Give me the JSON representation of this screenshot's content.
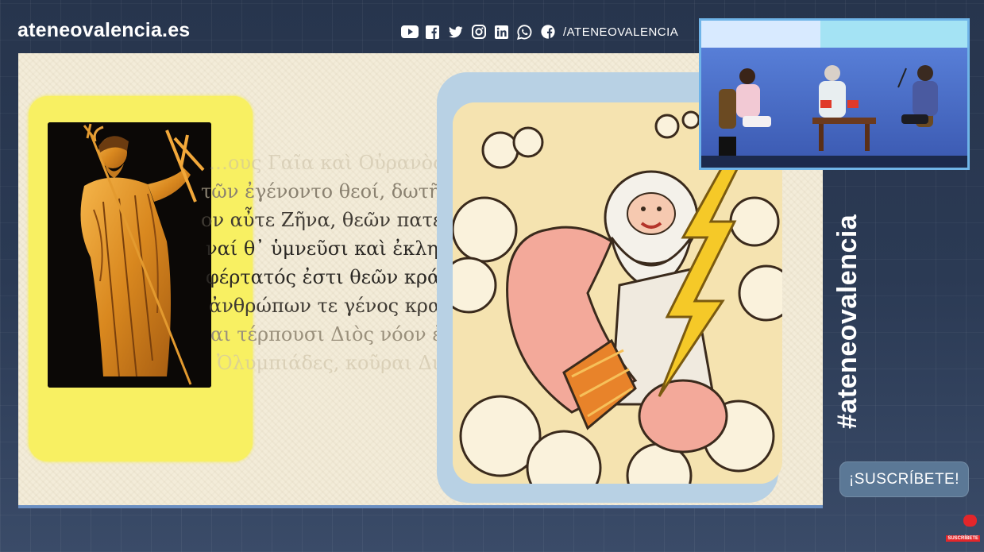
{
  "header": {
    "site_name": "ateneovalencia.es",
    "social_handle": "/ATENEOVALENCIA",
    "social_icons": [
      "youtube-icon",
      "facebook-icon",
      "twitter-icon",
      "instagram-icon",
      "linkedin-icon",
      "whatsapp-icon",
      "facebook-round-icon"
    ]
  },
  "slide": {
    "greek_lines": [
      "…ους Γαῖα καὶ Οὐρανὸς",
      "τῶν ἐγένοντο θεοί, δωτῆρ",
      "ον αὖτε Ζῆνα, θεῶν πατέρ",
      "ναί θ᾽ ὑμνεῦσι καὶ ἐκληγο",
      "φέρτατός ἐστι θεῶν κράτει",
      "ἀνθρώπων τε γένος κρατ",
      "αι τέρπουσι Διὸς νόον ἐντ",
      "Ὀλυμπιάδες, κοῦραι Διὸ"
    ]
  },
  "sidebar": {
    "hashtag": "#ateneovalencia",
    "subscribe_label": "¡SUSCRÍBETE!",
    "yt_badge_label": "SUSCRÍBETE"
  },
  "colors": {
    "background": "#2b3a54",
    "slide_bg": "#f3ecd9",
    "yellow_frame": "#f6ee3e",
    "blue_frame": "#b8d1e4",
    "subscribe_bg": "#5b7896",
    "pip_border": "#6fb4e8"
  }
}
